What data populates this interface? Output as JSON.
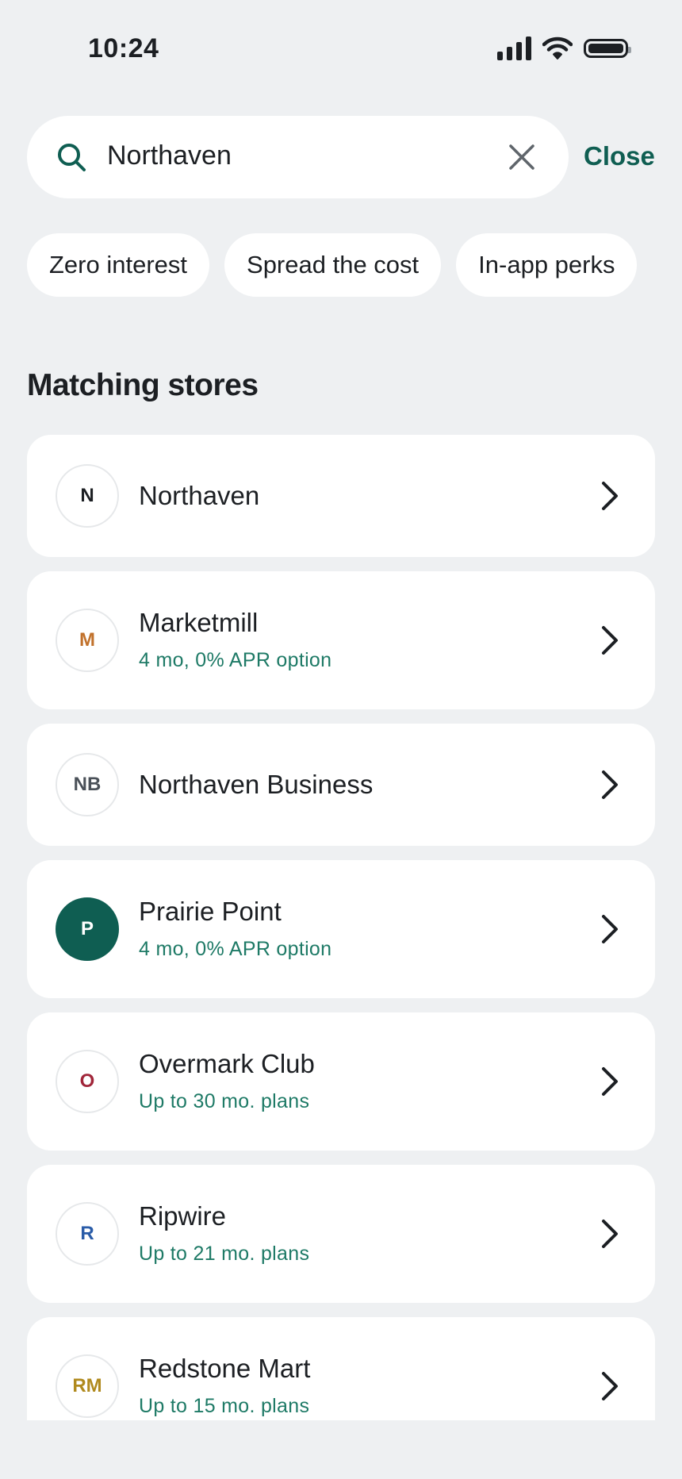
{
  "status_bar": {
    "time": "10:24"
  },
  "search": {
    "value": "Northaven",
    "close_label": "Close"
  },
  "chips": [
    "Zero interest",
    "Spread the cost",
    "In-app perks"
  ],
  "section_title": "Matching stores",
  "stores": [
    {
      "initials": "N",
      "name": "Northaven",
      "subtitle": "",
      "initial_color": "#1c1f23",
      "filled": false
    },
    {
      "initials": "M",
      "name": "Marketmill",
      "subtitle": "4 mo, 0% APR option",
      "initial_color": "#c1712b",
      "filled": false
    },
    {
      "initials": "NB",
      "name": "Northaven Business",
      "subtitle": "",
      "initial_color": "#4a5058",
      "filled": false
    },
    {
      "initials": "P",
      "name": "Prairie Point",
      "subtitle": "4 mo, 0% APR option",
      "initial_color": "#ffffff",
      "filled": true
    },
    {
      "initials": "O",
      "name": "Overmark Club",
      "subtitle": "Up to 30 mo. plans",
      "initial_color": "#a1263a",
      "filled": false
    },
    {
      "initials": "R",
      "name": "Ripwire",
      "subtitle": "Up to 21 mo. plans",
      "initial_color": "#2a5ca8",
      "filled": false
    },
    {
      "initials": "RM",
      "name": "Redstone Mart",
      "subtitle": "Up to 15 mo. plans",
      "initial_color": "#b08a1e",
      "filled": false
    }
  ],
  "colors": {
    "accent": "#0f5e52",
    "subtitle_green": "#1e7a66",
    "background": "#eef0f2"
  },
  "icons": [
    "signal-icon",
    "wifi-icon",
    "battery-icon",
    "search-icon",
    "clear-icon",
    "chevron-right-icon"
  ]
}
